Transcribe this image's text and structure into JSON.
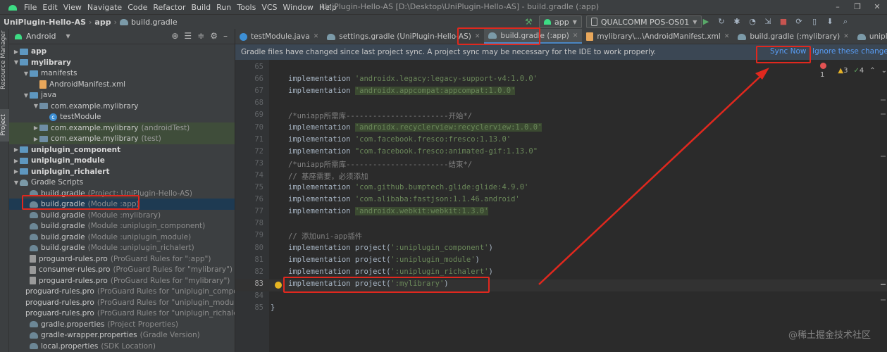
{
  "menubar": {
    "items": [
      "File",
      "Edit",
      "View",
      "Navigate",
      "Code",
      "Refactor",
      "Build",
      "Run",
      "Tools",
      "VCS",
      "Window",
      "Help"
    ],
    "title": "UniPlugin-Hello-AS [D:\\Desktop\\UniPlugin-Hello-AS] - build.gradle (:app)",
    "window_buttons": [
      "–",
      "❐",
      "✕"
    ]
  },
  "navbar": {
    "project": "UniPlugin-Hello-AS",
    "module": "app",
    "file": "build.gradle",
    "run_config": "app",
    "device": "QUALCOMM POS-OS01"
  },
  "toolstrip": {
    "resource_manager": "Resource Manager",
    "project": "Project"
  },
  "project_panel": {
    "view": "Android",
    "tree": [
      {
        "label": "app",
        "extra": "",
        "type": "module",
        "bold": true
      },
      {
        "label": "mylibrary",
        "extra": "",
        "type": "module",
        "bold": true
      },
      {
        "label": "manifests",
        "extra": "",
        "type": "folder"
      },
      {
        "label": "AndroidManifest.xml",
        "extra": "",
        "type": "xml"
      },
      {
        "label": "java",
        "extra": "",
        "type": "folder"
      },
      {
        "label": "com.example.mylibrary",
        "extra": "",
        "type": "package"
      },
      {
        "label": "testModule",
        "extra": "",
        "type": "class"
      },
      {
        "label": "com.example.mylibrary",
        "extra": "(androidTest)",
        "type": "package"
      },
      {
        "label": "com.example.mylibrary",
        "extra": "(test)",
        "type": "package"
      },
      {
        "label": "uniplugin_component",
        "extra": "",
        "type": "module",
        "bold": true
      },
      {
        "label": "uniplugin_module",
        "extra": "",
        "type": "module",
        "bold": true
      },
      {
        "label": "uniplugin_richalert",
        "extra": "",
        "type": "module",
        "bold": true
      },
      {
        "label": "Gradle Scripts",
        "extra": "",
        "type": "gradle-folder"
      },
      {
        "label": "build.gradle",
        "extra": "(Project: UniPlugin-Hello-AS)",
        "type": "gradle"
      },
      {
        "label": "build.gradle",
        "extra": "(Module :app)",
        "type": "gradle"
      },
      {
        "label": "build.gradle",
        "extra": "(Module :mylibrary)",
        "type": "gradle"
      },
      {
        "label": "build.gradle",
        "extra": "(Module :uniplugin_component)",
        "type": "gradle"
      },
      {
        "label": "build.gradle",
        "extra": "(Module :uniplugin_module)",
        "type": "gradle"
      },
      {
        "label": "build.gradle",
        "extra": "(Module :uniplugin_richalert)",
        "type": "gradle"
      },
      {
        "label": "proguard-rules.pro",
        "extra": "(ProGuard Rules for \":app\")",
        "type": "file"
      },
      {
        "label": "consumer-rules.pro",
        "extra": "(ProGuard Rules for \"mylibrary\")",
        "type": "file"
      },
      {
        "label": "proguard-rules.pro",
        "extra": "(ProGuard Rules for \"mylibrary\")",
        "type": "file"
      },
      {
        "label": "proguard-rules.pro",
        "extra": "(ProGuard Rules for \"uniplugin_compon",
        "type": "file"
      },
      {
        "label": "proguard-rules.pro",
        "extra": "(ProGuard Rules for \"uniplugin_module\")",
        "type": "file"
      },
      {
        "label": "proguard-rules.pro",
        "extra": "(ProGuard Rules for \"uniplugin_richalert",
        "type": "file"
      },
      {
        "label": "gradle.properties",
        "extra": "(Project Properties)",
        "type": "gradle"
      },
      {
        "label": "gradle-wrapper.properties",
        "extra": "(Gradle Version)",
        "type": "gradle"
      },
      {
        "label": "local.properties",
        "extra": "(SDK Location)",
        "type": "gradle"
      }
    ]
  },
  "tabs": [
    {
      "label": "testModule.java"
    },
    {
      "label": "settings.gradle (UniPlugin-Hello-AS)"
    },
    {
      "label": "build.gradle (:app)"
    },
    {
      "label": "mylibrary\\...\\AndroidManifest.xml"
    },
    {
      "label": "build.gradle (:mylibrary)"
    },
    {
      "label": "uniplugin_module\\...\\"
    }
  ],
  "notification": {
    "message": "Gradle files have changed since last project sync. A project sync may be necessary for the IDE to work properly.",
    "sync_now": "Sync Now",
    "ignore": "Ignore these changes"
  },
  "inspections": {
    "errors": "1",
    "warnings": "3",
    "ok": "4"
  },
  "editor_lines": [
    {
      "n": "65",
      "parts": [
        {
          "t": "",
          "c": "plain"
        }
      ]
    },
    {
      "n": "66",
      "parts": [
        {
          "t": "implementation ",
          "c": "plain"
        },
        {
          "t": "'androidx.legacy:legacy-support-v4:1.0.0'",
          "c": "str"
        }
      ]
    },
    {
      "n": "67",
      "parts": [
        {
          "t": "implementation ",
          "c": "plain"
        },
        {
          "t": "'androidx.appcompat:appcompat:1.0.0'",
          "c": "str-hl"
        }
      ]
    },
    {
      "n": "68",
      "parts": [
        {
          "t": "",
          "c": "plain"
        }
      ]
    },
    {
      "n": "69",
      "parts": [
        {
          "t": "/*uniapp所需库-----------------------开始*/",
          "c": "cmt"
        }
      ]
    },
    {
      "n": "70",
      "parts": [
        {
          "t": "implementation ",
          "c": "plain"
        },
        {
          "t": "'androidx.recyclerview:recyclerview:1.0.0'",
          "c": "str-hl"
        }
      ]
    },
    {
      "n": "71",
      "parts": [
        {
          "t": "implementation ",
          "c": "plain"
        },
        {
          "t": "'com.facebook.fresco:fresco:1.13.0'",
          "c": "str"
        }
      ]
    },
    {
      "n": "72",
      "parts": [
        {
          "t": "implementation ",
          "c": "plain"
        },
        {
          "t": "\"com.facebook.fresco:animated-gif:1.13.0\"",
          "c": "str"
        }
      ]
    },
    {
      "n": "73",
      "parts": [
        {
          "t": "/*uniapp所需库-----------------------结束*/",
          "c": "cmt"
        }
      ]
    },
    {
      "n": "74",
      "parts": [
        {
          "t": "// 基座需要，必须添加",
          "c": "cmt"
        }
      ]
    },
    {
      "n": "75",
      "parts": [
        {
          "t": "implementation ",
          "c": "plain"
        },
        {
          "t": "'com.github.bumptech.glide:glide:4.9.0'",
          "c": "str"
        }
      ]
    },
    {
      "n": "76",
      "parts": [
        {
          "t": "implementation ",
          "c": "plain"
        },
        {
          "t": "'com.alibaba:fastjson:1.1.46.android'",
          "c": "str"
        }
      ]
    },
    {
      "n": "77",
      "parts": [
        {
          "t": "implementation ",
          "c": "plain"
        },
        {
          "t": "'androidx.webkit:webkit:1.3.0'",
          "c": "str-hl"
        }
      ]
    },
    {
      "n": "78",
      "parts": [
        {
          "t": "",
          "c": "plain"
        }
      ]
    },
    {
      "n": "79",
      "parts": [
        {
          "t": "// 添加uni-app插件",
          "c": "cmt"
        }
      ]
    },
    {
      "n": "80",
      "parts": [
        {
          "t": "implementation project(",
          "c": "plain"
        },
        {
          "t": "':uniplugin_component'",
          "c": "str"
        },
        {
          "t": ")",
          "c": "plain"
        }
      ]
    },
    {
      "n": "81",
      "parts": [
        {
          "t": "implementation project(",
          "c": "plain"
        },
        {
          "t": "':uniplugin_module'",
          "c": "str"
        },
        {
          "t": ")",
          "c": "plain"
        }
      ]
    },
    {
      "n": "82",
      "parts": [
        {
          "t": "implementation project(",
          "c": "plain"
        },
        {
          "t": "':uniplugin_richalert'",
          "c": "str"
        },
        {
          "t": ")",
          "c": "plain"
        }
      ]
    },
    {
      "n": "83",
      "parts": [
        {
          "t": "implementation project(",
          "c": "plain"
        },
        {
          "t": "':mylibrary'",
          "c": "str"
        },
        {
          "t": ")",
          "c": "plain"
        }
      ]
    },
    {
      "n": "84",
      "parts": [
        {
          "t": "",
          "c": "plain"
        }
      ]
    },
    {
      "n": "85",
      "parts": [
        {
          "t": "}",
          "c": "brace"
        }
      ]
    }
  ],
  "watermark": "@稀土掘金技术社区",
  "colors": {
    "annotation": "#e0281e",
    "link": "#589df6",
    "string": "#6a8759",
    "comment": "#808080"
  }
}
